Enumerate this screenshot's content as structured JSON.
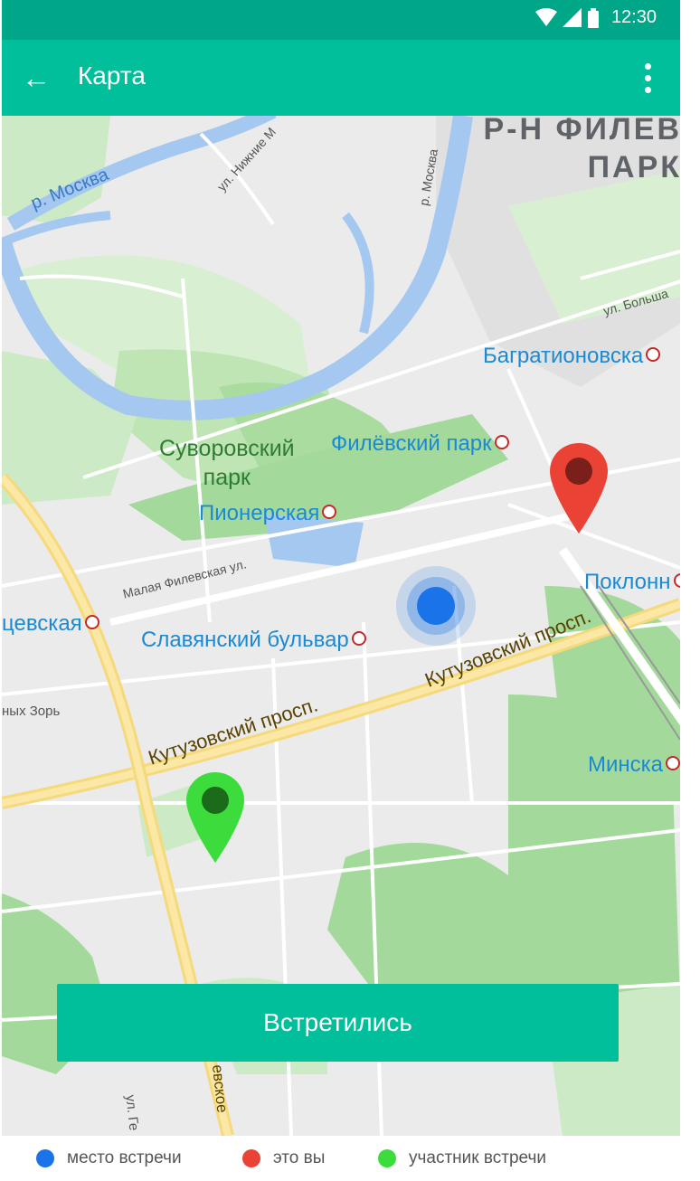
{
  "status_bar": {
    "time": "12:30"
  },
  "app_bar": {
    "title": "Карта",
    "back_icon": "arrow-left-icon",
    "menu_icon": "more-vert-icon"
  },
  "map": {
    "district": [
      "Р-Н ФИЛЕВ",
      "ПАРК"
    ],
    "metro_stations": [
      "Багратионовска",
      "Филёвский парк",
      "Пионерская",
      "цевская",
      "Славянский бульвар",
      "Поклонн",
      "Минска"
    ],
    "parks": [
      "Суворовский",
      "парк"
    ],
    "streets": {
      "nizhnie": "ул. Нижние М",
      "bolshaya": "ул. Больша",
      "malaya_filevskaya": "Малая Филевская ул.",
      "kutuzovsky": "Кутузовский просп.",
      "zor": "ных Зорь",
      "vertical": "р. Москва",
      "bottom_street": "ул. Ге",
      "bottom_avenue": "евское"
    },
    "river": "р. Москва"
  },
  "markers": {
    "meeting_place": {
      "color": "#1a73e8"
    },
    "you": {
      "color": "#ea4335"
    },
    "participant": {
      "color": "#3ddc3d"
    }
  },
  "button": {
    "label": "Встретились"
  },
  "legend": [
    {
      "label": "место встречи",
      "color": "#1a73e8"
    },
    {
      "label": "это вы",
      "color": "#ea4335"
    },
    {
      "label": "участник встречи",
      "color": "#3ddc3d"
    }
  ]
}
